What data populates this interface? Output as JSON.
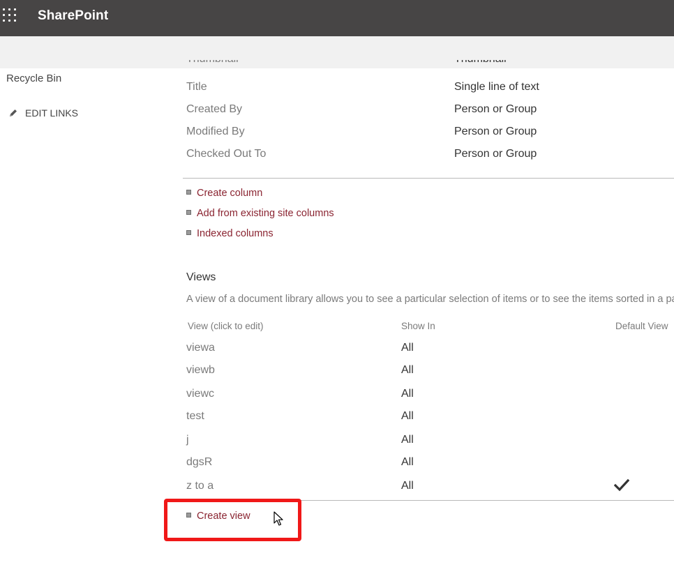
{
  "suite_bar": {
    "app_launcher_icon": "waffle-icon",
    "brand": "SharePoint"
  },
  "left_nav": {
    "items": [
      {
        "label": "Recycle Bin"
      }
    ],
    "edit_links": {
      "label": "EDIT LINKS",
      "icon": "pencil-icon"
    }
  },
  "columns": {
    "clipped_row": {
      "name": "Thumbnail",
      "type": "Thumbnail"
    },
    "rows": [
      {
        "name": "Title",
        "type": "Single line of text"
      },
      {
        "name": "Created By",
        "type": "Person or Group"
      },
      {
        "name": "Modified By",
        "type": "Person or Group"
      },
      {
        "name": "Checked Out To",
        "type": "Person or Group"
      }
    ],
    "links": [
      "Create column",
      "Add from existing site columns",
      "Indexed columns"
    ]
  },
  "views": {
    "title": "Views",
    "description": "A view of a document library allows you to see a particular selection of items or to see the items sorted in a particular order.",
    "headers": {
      "view": "View (click to edit)",
      "show_in": "Show In",
      "default_view": "Default View"
    },
    "rows": [
      {
        "name": "viewa",
        "show_in": "All",
        "default": false
      },
      {
        "name": "viewb",
        "show_in": "All",
        "default": false
      },
      {
        "name": "viewc",
        "show_in": "All",
        "default": false
      },
      {
        "name": "test",
        "show_in": "All",
        "default": false
      },
      {
        "name": "j",
        "show_in": "All",
        "default": false
      },
      {
        "name": "dgsR",
        "show_in": "All",
        "default": false
      },
      {
        "name": "z to a",
        "show_in": "All",
        "default": true
      }
    ],
    "create_view_label": "Create view",
    "default_icon": "checkmark-icon"
  },
  "colors": {
    "suite_bar": "#474545",
    "ribbon": "#f1f1f1",
    "link": "#8a2431",
    "highlight": "#f01818"
  }
}
